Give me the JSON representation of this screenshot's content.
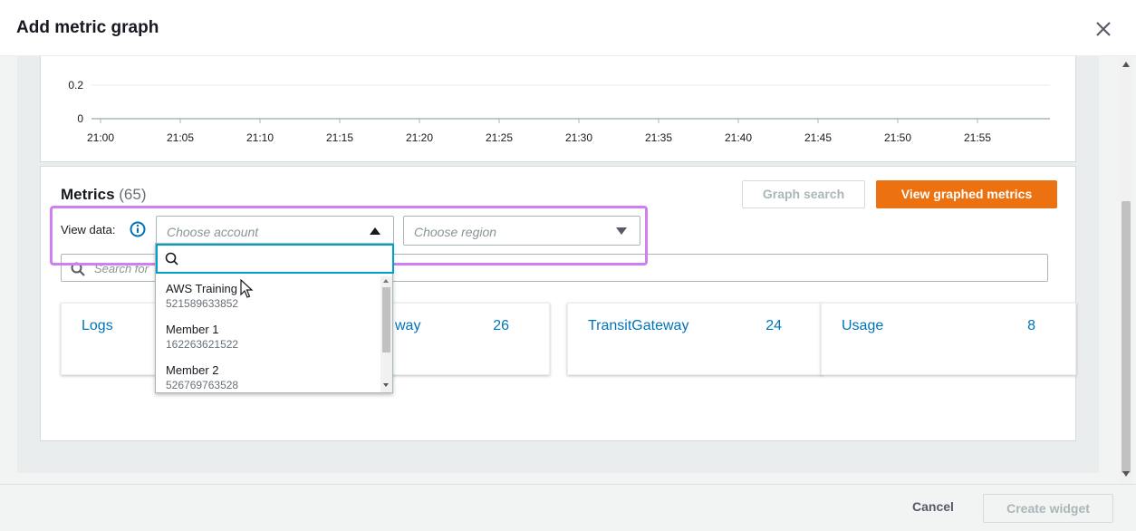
{
  "modal": {
    "title": "Add metric graph",
    "close_icon": "close-icon"
  },
  "graph": {
    "y_ticks": [
      "0.2",
      "0"
    ],
    "x_ticks": [
      "21:00",
      "21:05",
      "21:10",
      "21:15",
      "21:20",
      "21:25",
      "21:30",
      "21:35",
      "21:40",
      "21:45",
      "21:50",
      "21:55"
    ]
  },
  "metrics": {
    "title": "Metrics",
    "count": "(65)",
    "graph_search_label": "Graph search",
    "view_graphed_label": "View graphed metrics",
    "view_data_label": "View data:",
    "info_icon": "info-icon",
    "account_placeholder": "Choose account",
    "region_placeholder": "Choose region",
    "search_placeholder": "Search for"
  },
  "namespaces": [
    {
      "name": "Logs",
      "count": ""
    },
    {
      "name": "way",
      "count": "26"
    },
    {
      "name": "TransitGateway",
      "count": "24"
    },
    {
      "name": "Usage",
      "count": "8"
    }
  ],
  "dropdown": {
    "items": [
      {
        "name": "AWS Training",
        "id": "521589633852"
      },
      {
        "name": "Member 1",
        "id": "162263621522"
      },
      {
        "name": "Member 2",
        "id": "526769763528"
      }
    ]
  },
  "footer": {
    "cancel_label": "Cancel",
    "create_label": "Create widget"
  },
  "colors": {
    "accent": "#ec7211",
    "link": "#0073bb",
    "highlight": "#d17ff0",
    "focus": "#00a1c9"
  }
}
